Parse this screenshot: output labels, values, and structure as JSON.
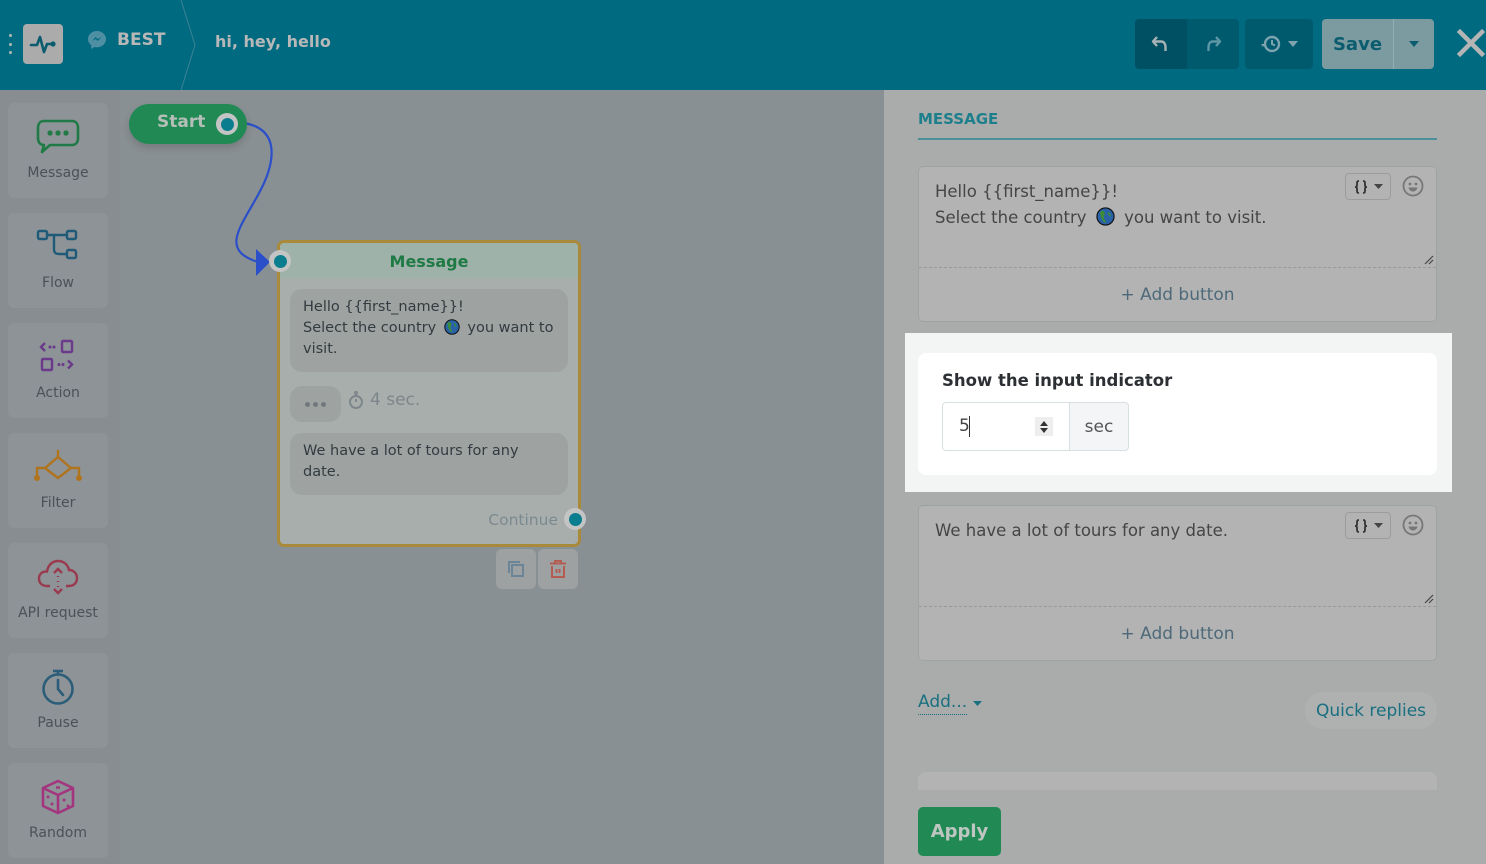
{
  "header": {
    "bot_name": "BEST",
    "flow_title": "hi, hey, hello",
    "save_label": "Save",
    "icons": [
      "menu-icon",
      "pulse-logo-icon",
      "messenger-icon",
      "undo-icon",
      "redo-icon",
      "history-icon",
      "chevron-down-icon",
      "close-icon"
    ]
  },
  "sidebar": {
    "items": [
      {
        "label": "Message",
        "icon": "chat-bubble-icon",
        "color": "#1f7a45"
      },
      {
        "label": "Flow",
        "icon": "flow-icon",
        "color": "#1f5b79"
      },
      {
        "label": "Action",
        "icon": "action-icon",
        "color": "#6b3a8a"
      },
      {
        "label": "Filter",
        "icon": "filter-icon",
        "color": "#b0731e"
      },
      {
        "label": "API request",
        "icon": "cloud-api-icon",
        "color": "#9a3a4e"
      },
      {
        "label": "Pause",
        "icon": "timer-icon",
        "color": "#2b5d78"
      },
      {
        "label": "Random",
        "icon": "dice-icon",
        "color": "#a3357f"
      }
    ]
  },
  "canvas": {
    "start_label": "Start",
    "message_node": {
      "title": "Message",
      "bubble1_line1": "Hello  {{first_name}}!",
      "bubble1_line2a": "Select the country",
      "bubble1_line2b": "you want to",
      "bubble1_line3": "visit.",
      "typing_delay": "4 sec.",
      "bubble2_line1": "We have a lot of tours for any",
      "bubble2_line2": "date.",
      "continue_label": "Continue"
    }
  },
  "panel": {
    "section_title": "MESSAGE",
    "editor1": {
      "line1": "Hello  {{first_name}}!",
      "line2a": "Select the country",
      "line2b": "you want to visit."
    },
    "add_button_label": "+ Add button",
    "indicator": {
      "label": "Show the input indicator",
      "value": "5",
      "unit": "sec"
    },
    "editor2": {
      "text": "We have a lot of tours for any date."
    },
    "add_menu_label": "Add...",
    "quick_replies_label": "Quick replies",
    "apply_label": "Apply"
  },
  "colors": {
    "topbar": "#006a80",
    "accent": "#1d7f8c",
    "success": "#218a54",
    "node_border": "#a88a3a",
    "connector": "#2a4fc9"
  }
}
